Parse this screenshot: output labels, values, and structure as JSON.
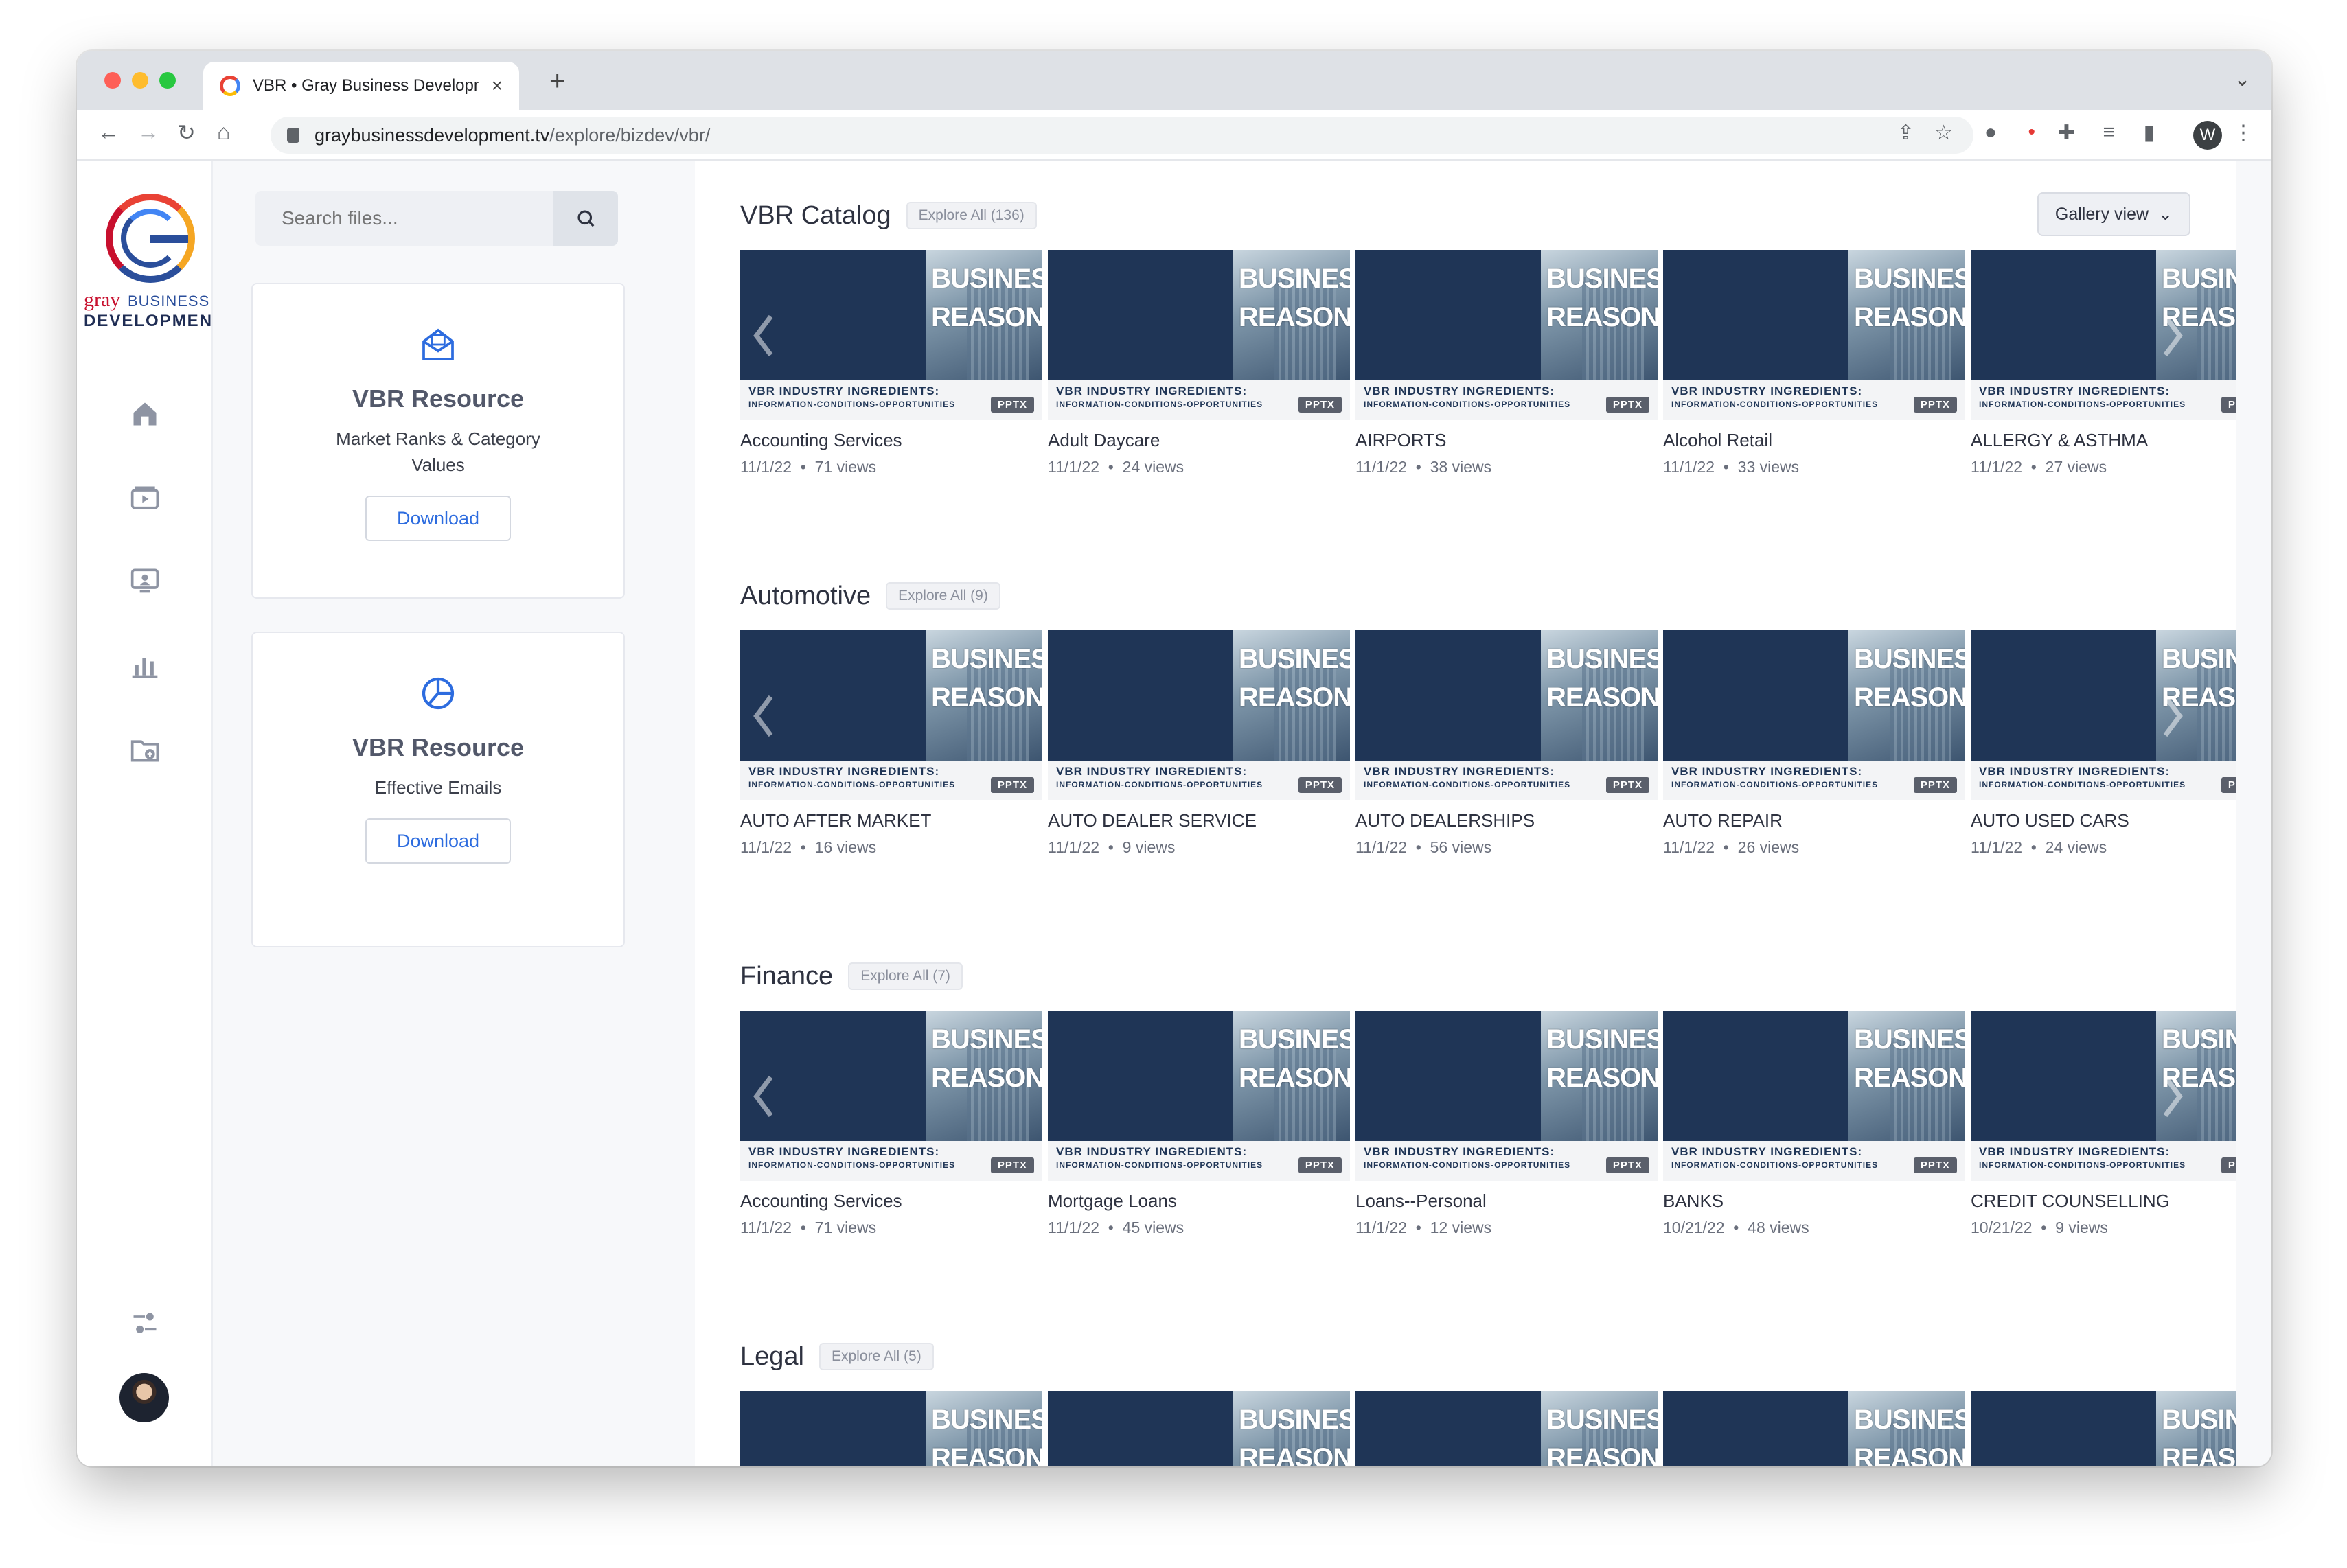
{
  "browser": {
    "tab_title": "VBR • Gray Business Developm",
    "tab_close": "×",
    "new_tab": "+",
    "url_host": "graybusinessdevelopment.tv",
    "url_path": "/explore/bizdev/vbr/",
    "profile_initial": "W"
  },
  "brand": {
    "logo_gray": "gray",
    "logo_business": "BUSINESS",
    "logo_development": "DEVELOPMENT",
    "colors": {
      "red": "#c8102e",
      "navy": "#2a4e9b",
      "teal": "#31a59c",
      "link": "#2d6cdf"
    }
  },
  "rail_icons": [
    "home-icon",
    "videos-icon",
    "presentation-icon",
    "chart-icon",
    "folder-add-icon",
    "settings-toggle-icon"
  ],
  "file_panel": {
    "search_placeholder": "Search files...",
    "cards": [
      {
        "icon": "envelope-icon",
        "title": "VBR Resource",
        "subtitle": "Market Ranks & Category Values",
        "button": "Download"
      },
      {
        "icon": "pie-chart-icon",
        "title": "VBR Resource",
        "subtitle": "Effective Emails",
        "button": "Download"
      }
    ]
  },
  "thumbnail": {
    "word1": "BUSINESS",
    "word2": "REASON",
    "caption1": "VBR INDUSTRY INGREDIENTS:",
    "caption2": "INFORMATION-CONDITIONS-OPPORTUNITIES",
    "badge": "PPTX"
  },
  "view_toggle": "Gallery view",
  "sections": [
    {
      "title": "VBR Catalog",
      "explore": "Explore All (136)",
      "items": [
        {
          "title": "Accounting Services",
          "date": "11/1/22",
          "views": "71 views"
        },
        {
          "title": "Adult Daycare",
          "date": "11/1/22",
          "views": "24 views"
        },
        {
          "title": "AIRPORTS",
          "date": "11/1/22",
          "views": "38 views"
        },
        {
          "title": "Alcohol Retail",
          "date": "11/1/22",
          "views": "33 views"
        },
        {
          "title": "ALLERGY & ASTHMA",
          "date": "11/1/22",
          "views": "27 views"
        }
      ]
    },
    {
      "title": "Automotive",
      "explore": "Explore All (9)",
      "items": [
        {
          "title": "AUTO AFTER MARKET",
          "date": "11/1/22",
          "views": "16 views"
        },
        {
          "title": "AUTO DEALER SERVICE",
          "date": "11/1/22",
          "views": "9 views"
        },
        {
          "title": "AUTO DEALERSHIPS",
          "date": "11/1/22",
          "views": "56 views"
        },
        {
          "title": "AUTO REPAIR",
          "date": "11/1/22",
          "views": "26 views"
        },
        {
          "title": "AUTO USED CARS",
          "date": "11/1/22",
          "views": "24 views"
        }
      ]
    },
    {
      "title": "Finance",
      "explore": "Explore All (7)",
      "items": [
        {
          "title": "Accounting Services",
          "date": "11/1/22",
          "views": "71 views"
        },
        {
          "title": "Mortgage Loans",
          "date": "11/1/22",
          "views": "45 views"
        },
        {
          "title": "Loans--Personal",
          "date": "11/1/22",
          "views": "12 views"
        },
        {
          "title": "BANKS",
          "date": "10/21/22",
          "views": "48 views"
        },
        {
          "title": "CREDIT COUNSELLING",
          "date": "10/21/22",
          "views": "9 views"
        }
      ]
    },
    {
      "title": "Legal",
      "explore": "Explore All (5)",
      "items": [
        {
          "title": "",
          "date": "",
          "views": ""
        },
        {
          "title": "",
          "date": "",
          "views": ""
        },
        {
          "title": "",
          "date": "",
          "views": ""
        },
        {
          "title": "",
          "date": "",
          "views": ""
        },
        {
          "title": "",
          "date": "",
          "views": ""
        }
      ]
    }
  ]
}
